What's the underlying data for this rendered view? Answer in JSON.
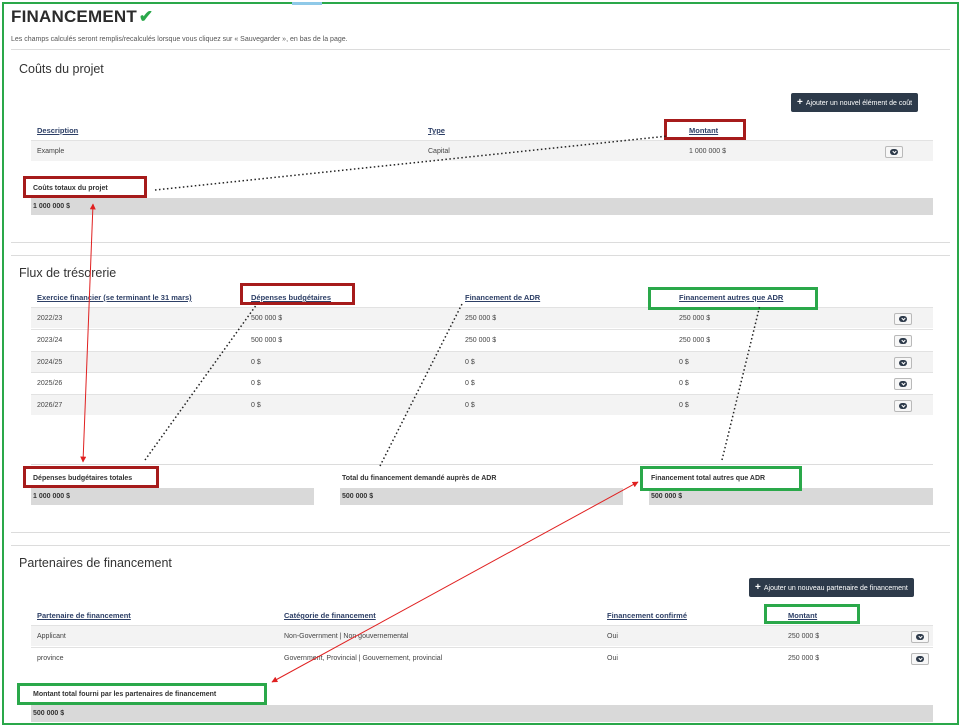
{
  "page": {
    "title": "FINANCEMENT",
    "title_check_icon": "check-icon",
    "hint": "Les champs calculés seront remplis/recalculés lorsque vous cliquez sur « Sauvegarder », en bas de la page."
  },
  "couts": {
    "title": "Coûts du projet",
    "add_button": "Ajouter un nouvel élément de coût",
    "headers": [
      "Description",
      "Type",
      "Montant"
    ],
    "rows": [
      {
        "description": "Example",
        "type": "Capital",
        "montant": "1 000 000 $"
      }
    ],
    "total_label": "Coûts totaux du projet",
    "total_value": "1 000 000 $"
  },
  "flux": {
    "title": "Flux de trésorerie",
    "headers": [
      "Exercice financier (se terminant le 31 mars)",
      "Dépenses budgétaires",
      "Financement de ADR",
      "Financement autres que ADR"
    ],
    "rows": [
      {
        "exercice": "2022/23",
        "depenses": "500 000 $",
        "adr": "250 000 $",
        "autres": "250 000 $"
      },
      {
        "exercice": "2023/24",
        "depenses": "500 000 $",
        "adr": "250 000 $",
        "autres": "250 000 $"
      },
      {
        "exercice": "2024/25",
        "depenses": "0 $",
        "adr": "0 $",
        "autres": "0 $"
      },
      {
        "exercice": "2025/26",
        "depenses": "0 $",
        "adr": "0 $",
        "autres": "0 $"
      },
      {
        "exercice": "2026/27",
        "depenses": "0 $",
        "adr": "0 $",
        "autres": "0 $"
      }
    ],
    "totals": [
      {
        "label": "Dépenses budgétaires totales",
        "value": "1 000 000 $"
      },
      {
        "label": "Total du financement demandé auprès de ADR",
        "value": "500 000 $"
      },
      {
        "label": "Financement total autres que ADR",
        "value": "500 000 $"
      }
    ]
  },
  "partenaires": {
    "title": "Partenaires de financement",
    "add_button": "Ajouter un nouveau partenaire de financement",
    "headers": [
      "Partenaire de financement",
      "Catégorie de financement",
      "Financement confirmé",
      "Montant"
    ],
    "rows": [
      {
        "partenaire": "Applicant",
        "categorie": "Non-Government | Non gouvernemental",
        "confirme": "Oui",
        "montant": "250 000 $"
      },
      {
        "partenaire": "province",
        "categorie": "Government, Provincial | Gouvernement, provincial",
        "confirme": "Oui",
        "montant": "250 000 $"
      }
    ],
    "total_label": "Montant total fourni par les partenaires de financement",
    "total_value": "500 000 $"
  },
  "colors": {
    "frame": "#2aa84a",
    "highlight_red": "#a61b1b",
    "highlight_green": "#2aa84a",
    "arrow": "#e02020",
    "button": "#2d3a4a",
    "header_link": "#2d3f66"
  }
}
